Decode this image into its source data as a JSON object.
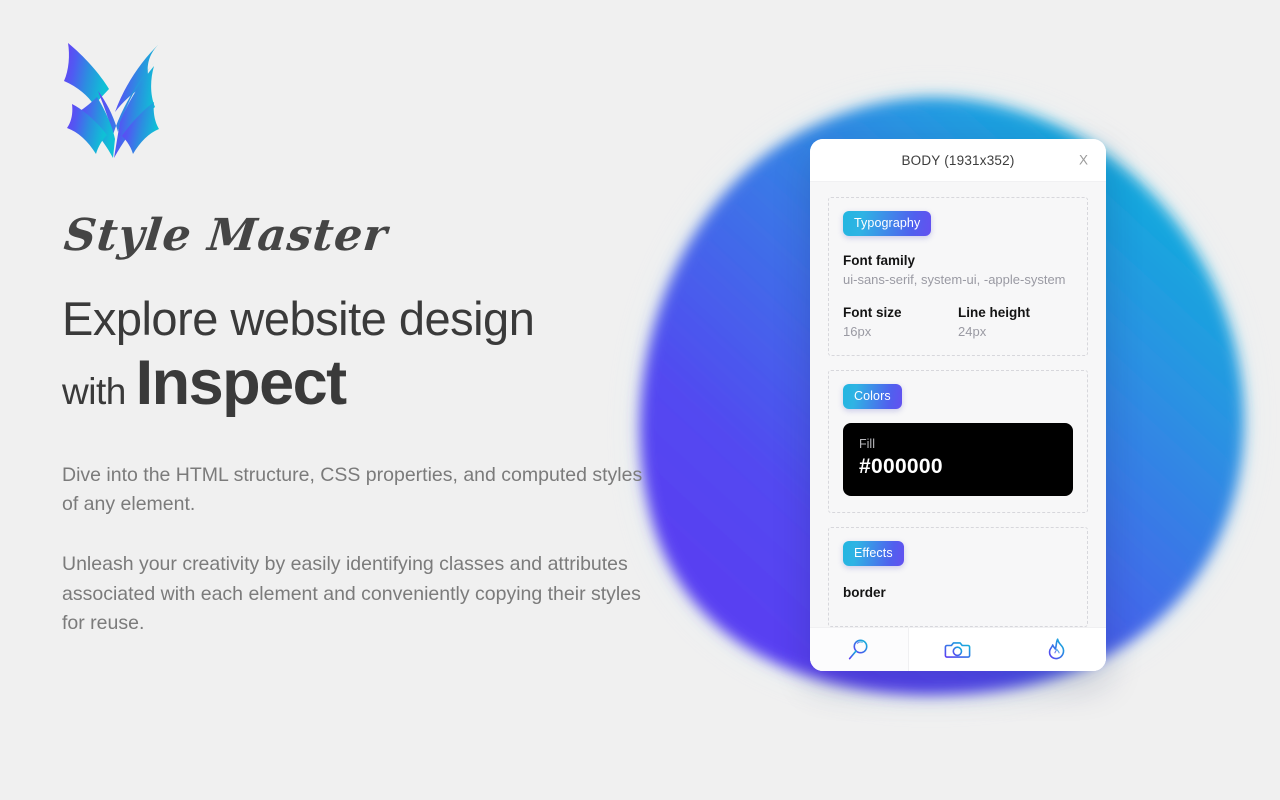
{
  "brand": {
    "logo_icon": "v-arrow-logo-icon",
    "script_title": "Style Master"
  },
  "headline": {
    "line1": "Explore website design",
    "with_word": "with ",
    "emphasis_word": "Inspect"
  },
  "paragraphs": {
    "p1": "Dive into the HTML structure, CSS properties, and computed styles of any element.",
    "p2": "Unleash your creativity by easily identifying classes and attributes associated with each element and conveniently copying their styles for reuse."
  },
  "inspector": {
    "header": {
      "title": "BODY (1931x352)",
      "close_label": "X"
    },
    "typography": {
      "badge": "Typography",
      "font_family_label": "Font family",
      "font_family_value": "ui-sans-serif, system-ui, -apple-system",
      "font_size_label": "Font size",
      "font_size_value": "16px",
      "line_height_label": "Line height",
      "line_height_value": "24px"
    },
    "colors": {
      "badge": "Colors",
      "fill_label": "Fill",
      "fill_value": "#000000",
      "fill_swatch_color": "#000000"
    },
    "effects": {
      "badge": "Effects",
      "first_property": "border"
    },
    "tabs": [
      {
        "icon": "magnifier-icon",
        "active": true
      },
      {
        "icon": "camera-icon",
        "active": false
      },
      {
        "icon": "flame-icon",
        "active": false
      }
    ]
  },
  "theme": {
    "background": "#f0f0f0",
    "gradient_start_cyan": "#12b2dc",
    "gradient_end_purple": "#5b4bf0",
    "heading_color": "#3a3a3a",
    "body_text_color": "#7b7b7b"
  }
}
